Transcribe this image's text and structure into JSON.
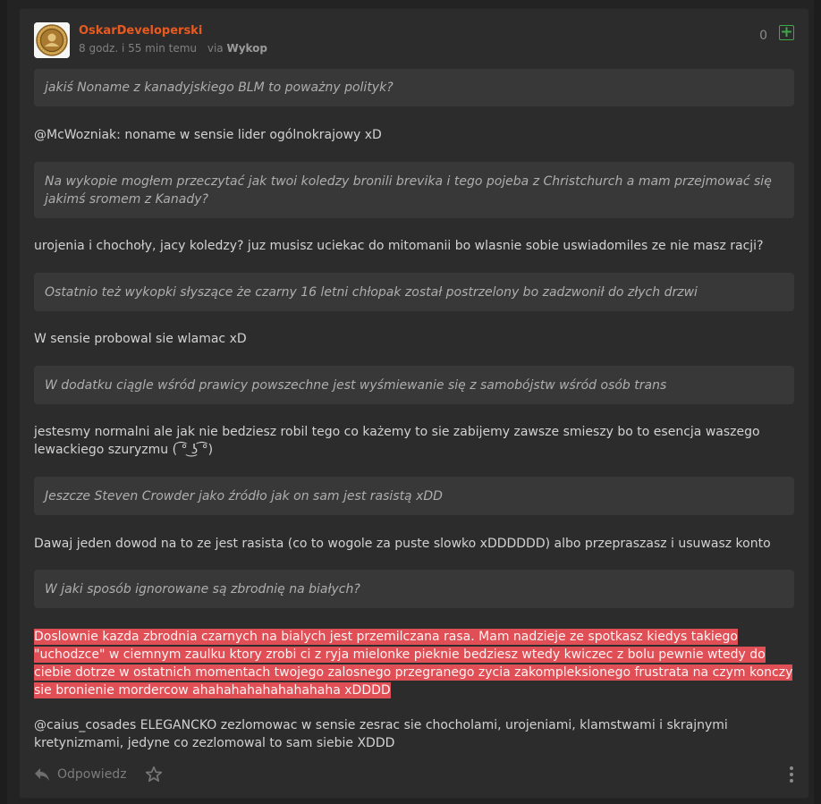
{
  "entry": {
    "author": "OskarDeveloperski",
    "time": "8 godz. i 55 min temu",
    "via_prefix": "via",
    "via_source": "Wykop",
    "votes": "0",
    "plus_icon": "plus-icon"
  },
  "content": {
    "q1": "jakiś Noname z kanadyjskiego BLM to poważny polityk?",
    "p1_mention": "@McWozniak",
    "p1_text": ": noname w sensie lider ogólnokrajowy xD",
    "q2": "Na wykopie mogłem przeczytać jak twoi koledzy bronili brevika i tego pojeba z Christchurch a mam przejmować się jakimś sromem z Kanady?",
    "p2": "urojenia i chochoły, jacy koledzy? juz musisz uciekac do mitomanii bo wlasnie sobie uswiadomiles ze nie masz racji?",
    "q3": "Ostatnio też wykopki słyszące że czarny 16 letni chłopak został postrzelony bo zadzwonił do złych drzwi",
    "p3": "W sensie probowal sie wlamac xD",
    "q4": "W dodatku ciągle wśród prawicy powszechne jest wyśmiewanie się z samobójstw wśród osób trans",
    "p4": "jestesmy normalni ale jak nie bedziesz robil tego co każemy to sie zabijemy zawsze smieszy bo to esencja waszego lewackiego szuryzmu ( ͡° ͜ʖ ͡°)",
    "q5": "Jeszcze Steven Crowder jako źródło jak on sam jest rasistą xDD",
    "p5": "Dawaj jeden dowod na to ze jest rasista (co to wogole za puste slowko xDDDDDD) albo przepraszasz i usuwasz konto",
    "q6": "W jaki sposób ignorowane są zbrodnię na białych?",
    "highlight": "Doslownie kazda zbrodnia czarnych na bialych jest przemilczana rasa. Mam nadzieje ze spotkasz kiedys takiego \"uchodzce\" w ciemnym zaulku ktory zrobi ci z ryja mielonke pieknie bedziesz wtedy kwiczec z bolu pewnie wtedy do ciebie dotrze w ostatnich momentach twojego zalosnego przegranego zycia zakompleksionego frustrata na czym konczy sie bronienie mordercow ahahahahahahahahaha xDDDD",
    "p6_mention": "@caius_cosades",
    "p6_text": " ELEGANCKO zezlomowac w sensie zesrac sie chocholami, urojeniami, klamstwami i skrajnymi kretynizmami, jedyne co zezlomowal to sam siebie XDDD"
  },
  "footer": {
    "reply_label": "Odpowiedz",
    "reply_icon": "reply-arrow-icon",
    "favorite_icon": "star-icon",
    "more_icon": "more-vertical-icon"
  },
  "colors": {
    "author": "#e85a20",
    "plus": "#3fa94a",
    "highlight": "#e04f55",
    "card": "#2c2c2c",
    "quote": "#383838"
  }
}
